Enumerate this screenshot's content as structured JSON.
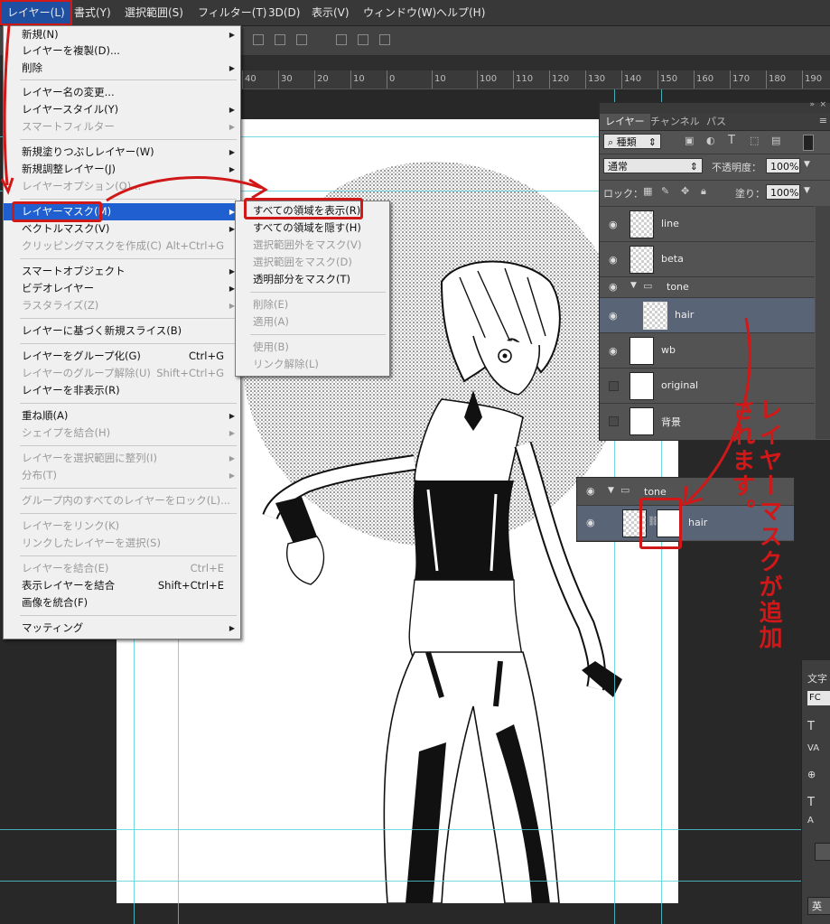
{
  "menubar": {
    "items": [
      "レイヤー(L)",
      "書式(Y)",
      "選択範囲(S)",
      "フィルター(T)",
      "3D(D)",
      "表示(V)",
      "ウィンドウ(W)",
      "ヘルプ(H)"
    ]
  },
  "ruler": {
    "ticks": [
      "40",
      "30",
      "20",
      "10",
      "0",
      "10",
      "100",
      "110",
      "120",
      "130",
      "140",
      "150",
      "160",
      "170",
      "180",
      "190"
    ]
  },
  "layer_menu": {
    "items": [
      {
        "label": "新規(N)",
        "shortcut": "",
        "submenu": true,
        "disabled": false
      },
      {
        "label": "レイヤーを複製(D)...",
        "shortcut": "",
        "submenu": false,
        "disabled": false
      },
      {
        "label": "削除",
        "shortcut": "",
        "submenu": true,
        "disabled": false
      },
      {
        "label": "レイヤー名の変更...",
        "shortcut": "",
        "submenu": false,
        "disabled": false
      },
      {
        "label": "レイヤースタイル(Y)",
        "shortcut": "",
        "submenu": true,
        "disabled": false
      },
      {
        "label": "スマートフィルター",
        "shortcut": "",
        "submenu": true,
        "disabled": true
      },
      {
        "label": "新規塗りつぶしレイヤー(W)",
        "shortcut": "",
        "submenu": true,
        "disabled": false
      },
      {
        "label": "新規調整レイヤー(J)",
        "shortcut": "",
        "submenu": true,
        "disabled": false
      },
      {
        "label": "レイヤーオプション(O)...",
        "shortcut": "",
        "submenu": false,
        "disabled": true
      },
      {
        "label": "レイヤーマスク(M)",
        "shortcut": "",
        "submenu": true,
        "disabled": false
      },
      {
        "label": "ベクトルマスク(V)",
        "shortcut": "",
        "submenu": true,
        "disabled": false
      },
      {
        "label": "クリッピングマスクを作成(C)",
        "shortcut": "Alt+Ctrl+G",
        "submenu": false,
        "disabled": true
      },
      {
        "label": "スマートオブジェクト",
        "shortcut": "",
        "submenu": true,
        "disabled": false
      },
      {
        "label": "ビデオレイヤー",
        "shortcut": "",
        "submenu": true,
        "disabled": false
      },
      {
        "label": "ラスタライズ(Z)",
        "shortcut": "",
        "submenu": true,
        "disabled": true
      },
      {
        "label": "レイヤーに基づく新規スライス(B)",
        "shortcut": "",
        "submenu": false,
        "disabled": false
      },
      {
        "label": "レイヤーをグループ化(G)",
        "shortcut": "Ctrl+G",
        "submenu": false,
        "disabled": false
      },
      {
        "label": "レイヤーのグループ解除(U)",
        "shortcut": "Shift+Ctrl+G",
        "submenu": false,
        "disabled": true
      },
      {
        "label": "レイヤーを非表示(R)",
        "shortcut": "",
        "submenu": false,
        "disabled": false
      },
      {
        "label": "重ね順(A)",
        "shortcut": "",
        "submenu": true,
        "disabled": false
      },
      {
        "label": "シェイプを結合(H)",
        "shortcut": "",
        "submenu": true,
        "disabled": true
      },
      {
        "label": "レイヤーを選択範囲に整列(I)",
        "shortcut": "",
        "submenu": true,
        "disabled": true
      },
      {
        "label": "分布(T)",
        "shortcut": "",
        "submenu": true,
        "disabled": true
      },
      {
        "label": "グループ内のすべてのレイヤーをロック(L)...",
        "shortcut": "",
        "submenu": false,
        "disabled": true
      },
      {
        "label": "レイヤーをリンク(K)",
        "shortcut": "",
        "submenu": false,
        "disabled": true
      },
      {
        "label": "リンクしたレイヤーを選択(S)",
        "shortcut": "",
        "submenu": false,
        "disabled": true
      },
      {
        "label": "レイヤーを結合(E)",
        "shortcut": "Ctrl+E",
        "submenu": false,
        "disabled": true
      },
      {
        "label": "表示レイヤーを結合",
        "shortcut": "Shift+Ctrl+E",
        "submenu": false,
        "disabled": false
      },
      {
        "label": "画像を統合(F)",
        "shortcut": "",
        "submenu": false,
        "disabled": false
      },
      {
        "label": "マッティング",
        "shortcut": "",
        "submenu": true,
        "disabled": false
      }
    ]
  },
  "mask_submenu": {
    "items": [
      {
        "label": "すべての領域を表示(R)",
        "disabled": false
      },
      {
        "label": "すべての領域を隠す(H)",
        "disabled": false
      },
      {
        "label": "選択範囲外をマスク(V)",
        "disabled": true
      },
      {
        "label": "選択範囲をマスク(D)",
        "disabled": true
      },
      {
        "label": "透明部分をマスク(T)",
        "disabled": false
      },
      {
        "label": "削除(E)",
        "disabled": true
      },
      {
        "label": "適用(A)",
        "disabled": true
      },
      {
        "label": "使用(B)",
        "disabled": true
      },
      {
        "label": "リンク解除(L)",
        "disabled": true
      }
    ]
  },
  "layers_panel": {
    "tabs": [
      "レイヤー",
      "チャンネル",
      "パス"
    ],
    "filter_label": "種類",
    "blend_mode": "通常",
    "opacity_label": "不透明度：",
    "opacity_value": "100%",
    "lock_label": "ロック：",
    "fill_label": "塗り：",
    "fill_value": "100%",
    "layers": [
      {
        "name": "line",
        "visible": true,
        "group": false
      },
      {
        "name": "beta",
        "visible": true,
        "group": false
      },
      {
        "name": "tone",
        "visible": true,
        "group": true
      },
      {
        "name": "hair",
        "visible": true,
        "group": false,
        "selected": true
      },
      {
        "name": "wb",
        "visible": true,
        "group": false
      },
      {
        "name": "original",
        "visible": false,
        "group": false
      },
      {
        "name": "背景",
        "visible": false,
        "group": false
      }
    ]
  },
  "popup_layers": {
    "group_name": "tone",
    "layer_name": "hair"
  },
  "char_panel": {
    "title": "文字",
    "font_prefix": "FC",
    "bottom_label": "英"
  },
  "annotation": {
    "text": "レイヤーマスクが追加されます。",
    "color": "#d01818"
  }
}
